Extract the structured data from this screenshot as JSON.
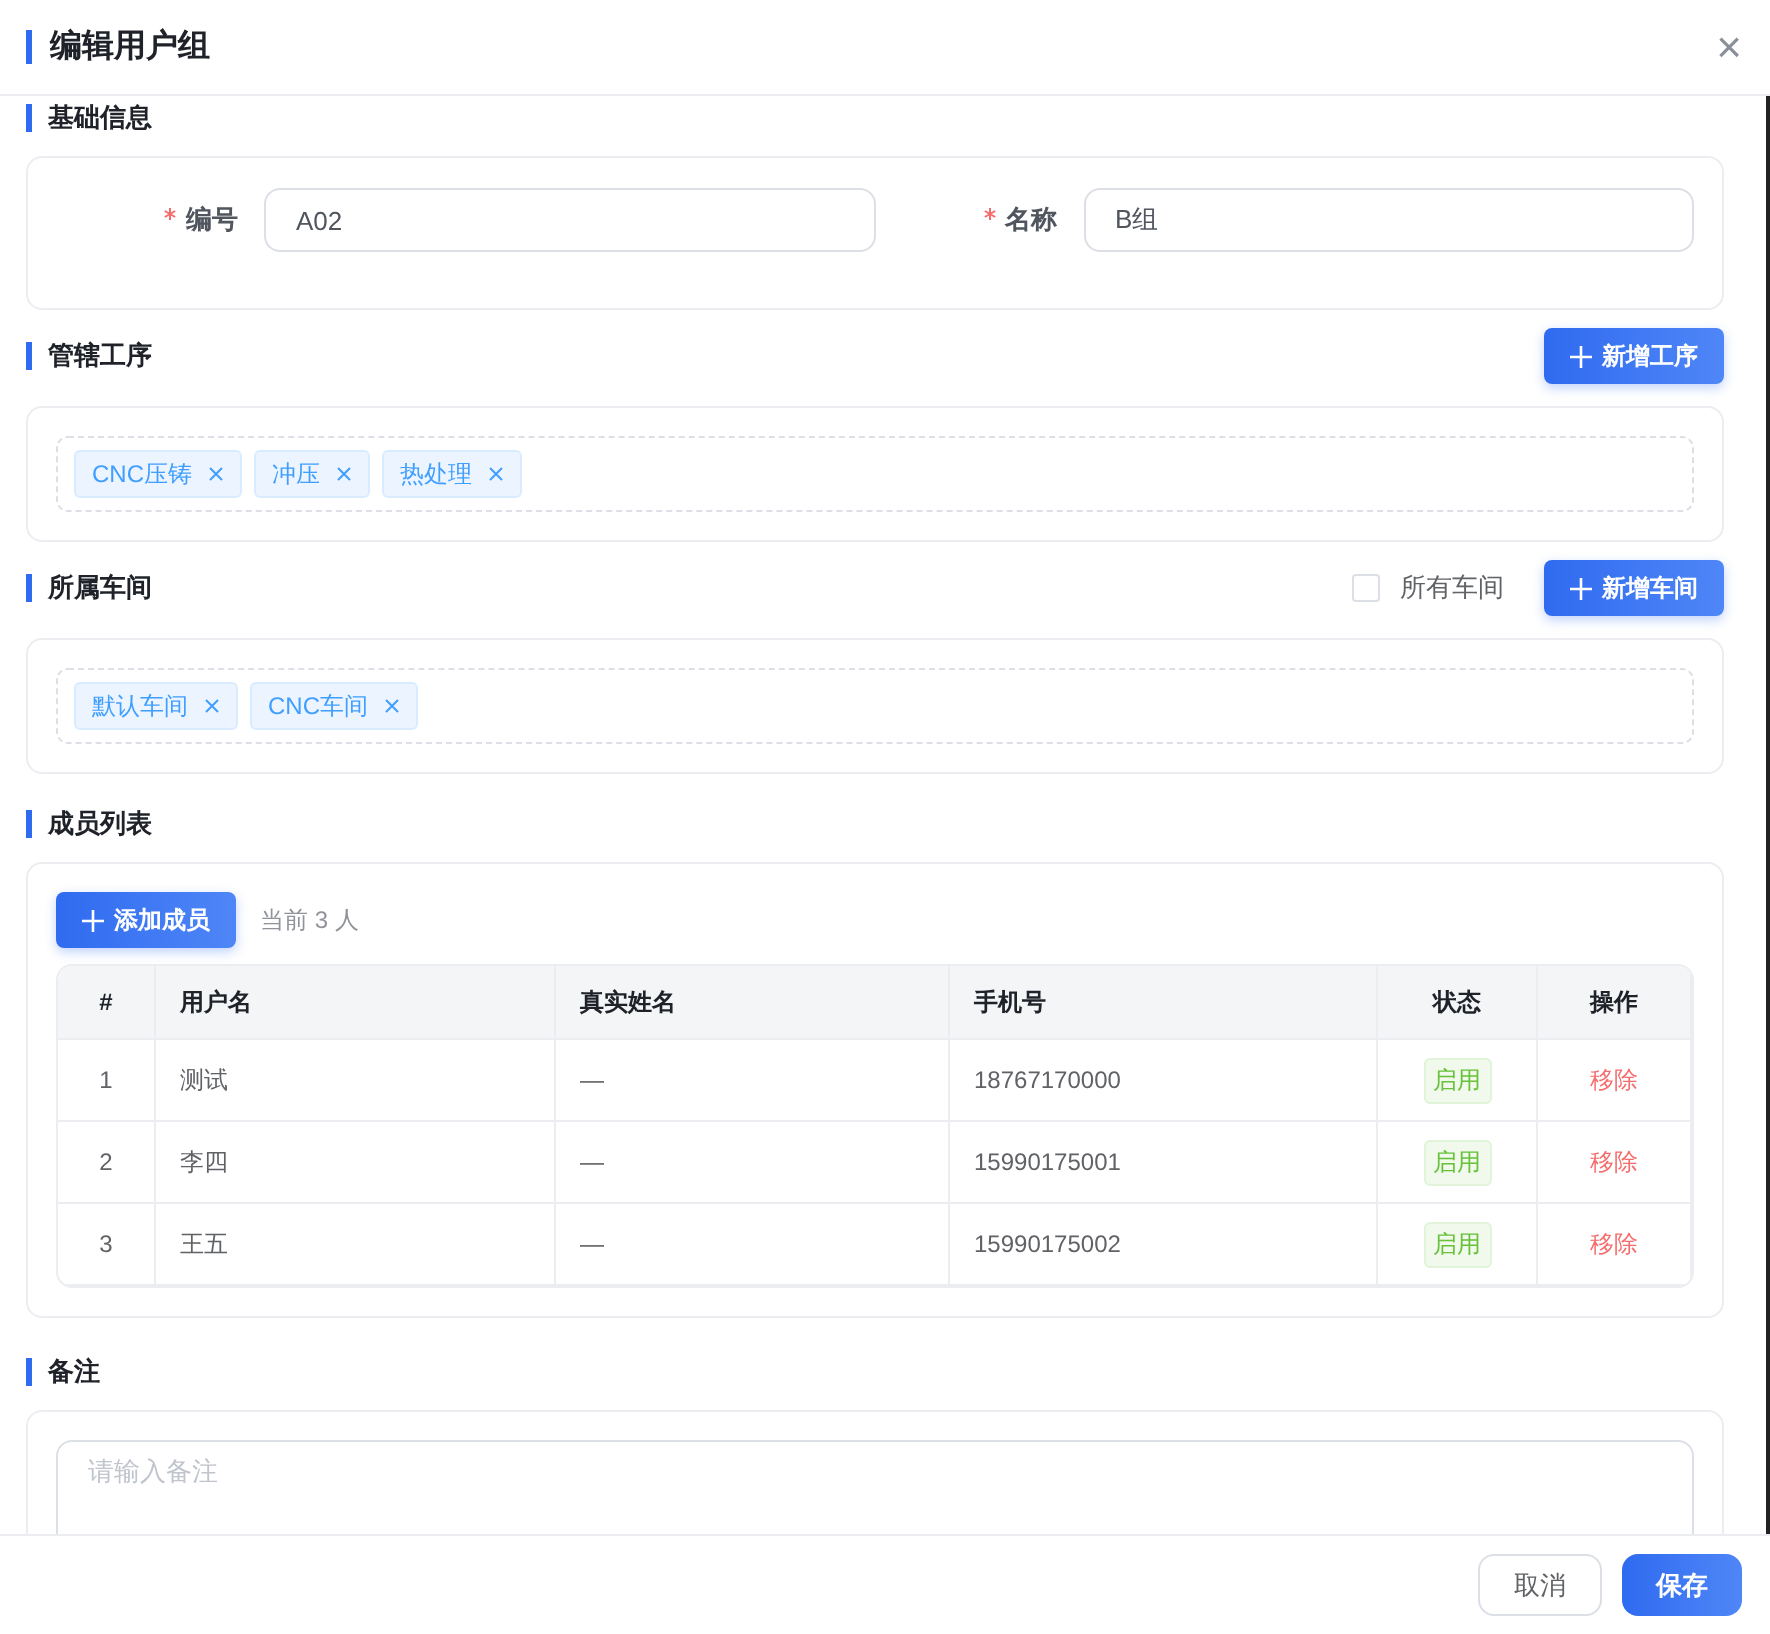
{
  "dialog": {
    "title": "编辑用户组",
    "close": "×"
  },
  "basic": {
    "title": "基础信息",
    "fields": [
      {
        "label": "编号",
        "required": true,
        "value": "A02"
      },
      {
        "label": "名称",
        "required": true,
        "value": "B组"
      }
    ]
  },
  "processes": {
    "title": "管辖工序",
    "button": "新增工序",
    "tags": [
      "CNC压铸",
      "冲压",
      "热处理"
    ]
  },
  "workshops": {
    "title": "所属车间",
    "checkbox": {
      "label": "所有车间",
      "checked": false
    },
    "button": "新增车间",
    "tags": [
      "默认车间",
      "CNC车间"
    ]
  },
  "members": {
    "title": "成员列表",
    "button": "添加成员",
    "count": "当前 3 人",
    "columns": [
      "#",
      "用户名",
      "真实姓名",
      "手机号",
      "状态",
      "操作"
    ],
    "rows": [
      {
        "index": "1",
        "username": "测试",
        "real_name": "—",
        "phone": "18767170000",
        "status": "启用",
        "action": "移除"
      },
      {
        "index": "2",
        "username": "李四",
        "real_name": "—",
        "phone": "15990175001",
        "status": "启用",
        "action": "移除"
      },
      {
        "index": "3",
        "username": "王五",
        "real_name": "—",
        "phone": "15990175002",
        "status": "启用",
        "action": "移除"
      }
    ]
  },
  "remark": {
    "title": "备注",
    "placeholder": "请输入备注"
  },
  "footer": {
    "buttons": [
      {
        "label": "取消",
        "kind": "secondary"
      },
      {
        "label": "保存",
        "kind": "primary"
      }
    ]
  }
}
